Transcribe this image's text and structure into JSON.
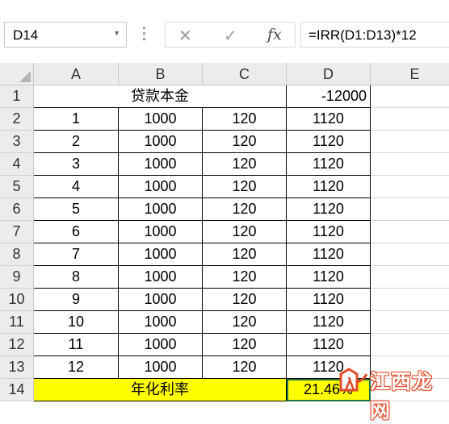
{
  "formula_bar": {
    "name_box": "D14",
    "cancel_icon": "close-icon",
    "enter_icon": "check-icon",
    "fx_label": "fx",
    "formula": "=IRR(D1:D13)*12"
  },
  "columns": [
    "A",
    "B",
    "C",
    "D",
    "E"
  ],
  "rows": [
    "1",
    "2",
    "3",
    "4",
    "5",
    "6",
    "7",
    "8",
    "9",
    "10",
    "11",
    "12",
    "13",
    "14"
  ],
  "cells": {
    "r1": {
      "merged_ac": "贷款本金",
      "d": "-12000"
    },
    "data": [
      {
        "a": "1",
        "b": "1000",
        "c": "120",
        "d": "1120"
      },
      {
        "a": "2",
        "b": "1000",
        "c": "120",
        "d": "1120"
      },
      {
        "a": "3",
        "b": "1000",
        "c": "120",
        "d": "1120"
      },
      {
        "a": "4",
        "b": "1000",
        "c": "120",
        "d": "1120"
      },
      {
        "a": "5",
        "b": "1000",
        "c": "120",
        "d": "1120"
      },
      {
        "a": "6",
        "b": "1000",
        "c": "120",
        "d": "1120"
      },
      {
        "a": "7",
        "b": "1000",
        "c": "120",
        "d": "1120"
      },
      {
        "a": "8",
        "b": "1000",
        "c": "120",
        "d": "1120"
      },
      {
        "a": "9",
        "b": "1000",
        "c": "120",
        "d": "1120"
      },
      {
        "a": "10",
        "b": "1000",
        "c": "120",
        "d": "1120"
      },
      {
        "a": "11",
        "b": "1000",
        "c": "120",
        "d": "1120"
      },
      {
        "a": "12",
        "b": "1000",
        "c": "120",
        "d": "1120"
      }
    ],
    "r14": {
      "merged_ac": "年化利率",
      "d": "21.46%"
    }
  },
  "colors": {
    "highlight": "#ffff00",
    "header_bg": "#ececec",
    "watermark": "#e24a2a"
  },
  "watermark": {
    "text": "江西龙网"
  }
}
